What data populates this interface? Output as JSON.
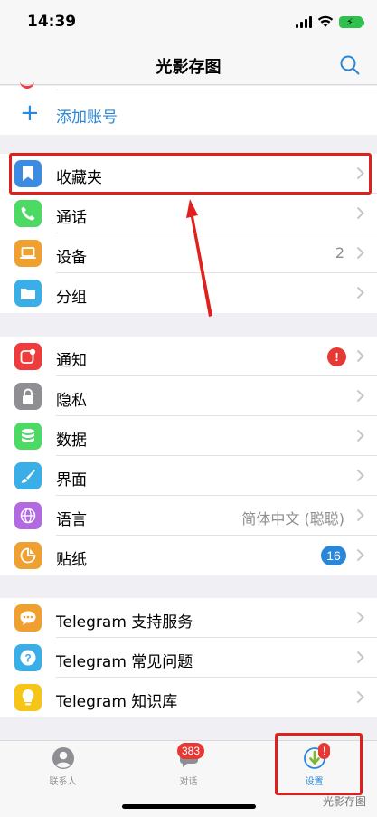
{
  "status_bar": {
    "time": "14:39"
  },
  "nav": {
    "title": "光影存图",
    "search_icon": "search-icon"
  },
  "account": {
    "add_label": "添加账号"
  },
  "group1": [
    {
      "label": "收藏夹",
      "icon": "bookmark-icon",
      "color": "#3b8ce0"
    },
    {
      "label": "通话",
      "icon": "phone-icon",
      "color": "#4cd964"
    },
    {
      "label": "设备",
      "icon": "laptop-icon",
      "color": "#f0a030",
      "value": "2"
    },
    {
      "label": "分组",
      "icon": "folder-icon",
      "color": "#3aaee6"
    }
  ],
  "group2": [
    {
      "label": "通知",
      "icon": "notification-icon",
      "color": "#ef3b3b",
      "badge": "!"
    },
    {
      "label": "隐私",
      "icon": "lock-icon",
      "color": "#8e8e93"
    },
    {
      "label": "数据",
      "icon": "database-icon",
      "color": "#4cd964"
    },
    {
      "label": "界面",
      "icon": "brush-icon",
      "color": "#3aaee6"
    },
    {
      "label": "语言",
      "icon": "globe-icon",
      "color": "#b36ae0",
      "value": "简体中文 (聪聪)"
    },
    {
      "label": "贴纸",
      "icon": "sticker-icon",
      "color": "#f0a030",
      "badge": "16"
    }
  ],
  "group3": [
    {
      "label": "Telegram 支持服务",
      "icon": "chat-bubble-icon",
      "color": "#f0a030"
    },
    {
      "label": "Telegram 常见问题",
      "icon": "question-icon",
      "color": "#3aaee6"
    },
    {
      "label": "Telegram 知识库",
      "icon": "lightbulb-icon",
      "color": "#f5c518"
    }
  ],
  "tabs": [
    {
      "label": "联系人",
      "icon": "contacts-icon"
    },
    {
      "label": "对话",
      "icon": "chats-icon",
      "badge": "383"
    },
    {
      "label": "设置",
      "icon": "settings-icon",
      "badge": "!"
    }
  ],
  "watermark": "光影存图",
  "colors": {
    "accent": "#2a86d8",
    "highlight": "#e0201c",
    "badge": "#e53935"
  }
}
